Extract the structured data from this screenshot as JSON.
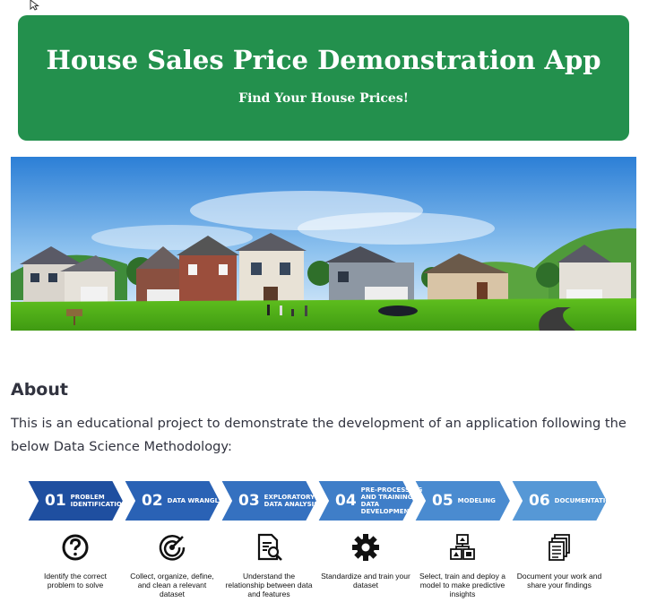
{
  "header": {
    "title": "House Sales Price Demonstration App",
    "subtitle": "Find Your House Prices!"
  },
  "colors": {
    "banner_bg": "#23904d",
    "chevron_shades": [
      "#1f4fa0",
      "#2a62b5",
      "#3571c0",
      "#3f7ec8",
      "#4a8bd0",
      "#5698d6"
    ]
  },
  "about": {
    "heading": "About",
    "text": "This is an educational project to demonstrate the development of an application following the below Data Science Methodology:"
  },
  "methodology": {
    "steps": [
      {
        "number": "01",
        "name": "PROBLEM IDENTIFICATION",
        "description": "Identify the correct problem to solve",
        "icon": "question-icon"
      },
      {
        "number": "02",
        "name": "DATA WRANGLING",
        "description": "Collect, organize, define, and clean a relevant dataset",
        "icon": "target-icon"
      },
      {
        "number": "03",
        "name": "EXPLORATORY DATA ANALYSIS",
        "description": "Understand the relationship between data and features",
        "icon": "document-search-icon"
      },
      {
        "number": "04",
        "name": "PRE-PROCESSING AND TRAINING DATA DEVELOPMENT",
        "description": "Standardize and train your dataset",
        "icon": "gear-icon"
      },
      {
        "number": "05",
        "name": "MODELING",
        "description": "Select, train and deploy a model to make predictive insights",
        "icon": "blocks-icon"
      },
      {
        "number": "06",
        "name": "DOCUMENTATION",
        "description": "Document your work and share your findings",
        "icon": "documents-icon"
      }
    ]
  }
}
